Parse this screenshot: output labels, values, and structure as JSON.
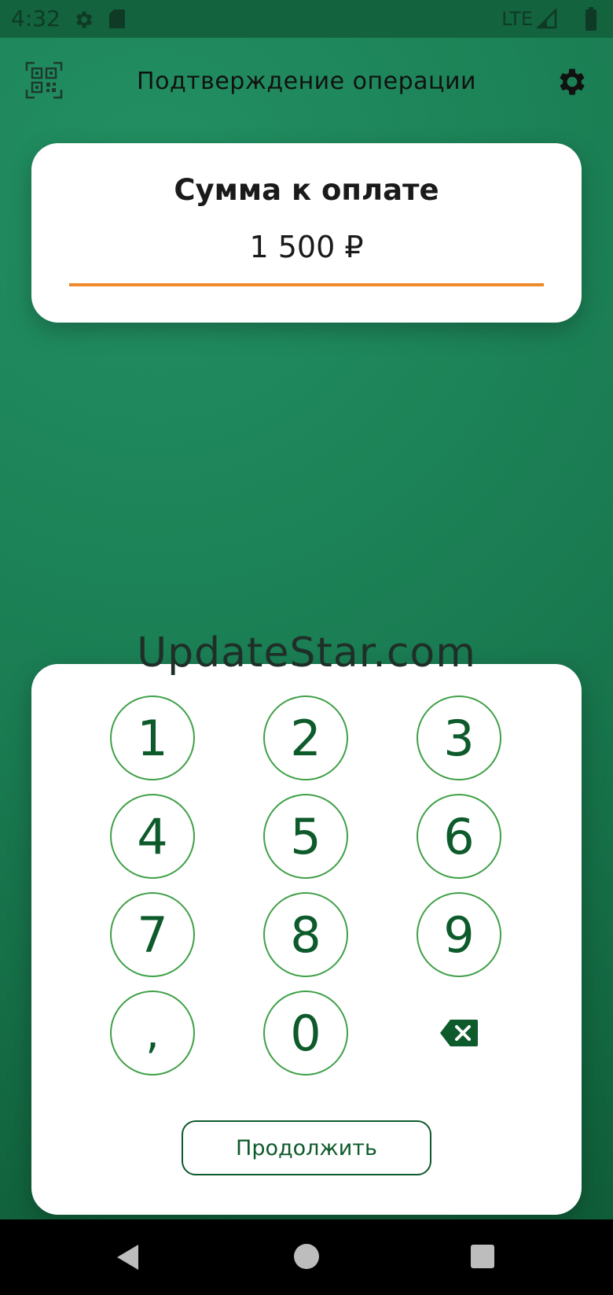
{
  "status_bar": {
    "time": "4:32",
    "network": "LTE",
    "icons": [
      "gear-icon",
      "sd-card-icon",
      "signal-icon",
      "battery-icon"
    ]
  },
  "app_bar": {
    "title": "Подтверждение операции",
    "left_icon": "qr-code-icon",
    "right_icon": "settings-icon"
  },
  "sum_card": {
    "title": "Сумма к оплате",
    "amount": "1 500 ₽",
    "accent_color": "#ee8a2b"
  },
  "watermark": "UpdateStar.com",
  "keypad": {
    "keys": [
      "1",
      "2",
      "3",
      "4",
      "5",
      "6",
      "7",
      "8",
      "9",
      ",",
      "0"
    ],
    "backspace_icon": "backspace-icon",
    "key_color": "#0d5a2b",
    "border_color": "#3fa047"
  },
  "continue_button": {
    "label": "Продолжить"
  },
  "nav_bar": {
    "icons": [
      "back-icon",
      "home-icon",
      "recents-icon"
    ]
  },
  "colors": {
    "background": "#1a7c52",
    "card": "#ffffff"
  }
}
